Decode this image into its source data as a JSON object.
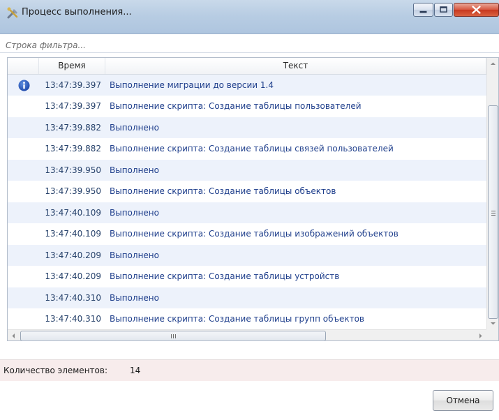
{
  "window": {
    "title": "Процесс выполнения...",
    "icon": "tools-icon"
  },
  "filter": {
    "placeholder": "Строка фильтра..."
  },
  "grid": {
    "columns": {
      "icon": "",
      "time": "Время",
      "text": "Текст"
    },
    "rows": [
      {
        "icon": "info-icon",
        "time": "13:47:39.397",
        "text": "Выполнение миграции до версии 1.4"
      },
      {
        "icon": "",
        "time": "13:47:39.397",
        "text": "Выполнение скрипта: Создание таблицы пользователей"
      },
      {
        "icon": "",
        "time": "13:47:39.882",
        "text": "Выполнено"
      },
      {
        "icon": "",
        "time": "13:47:39.882",
        "text": "Выполнение скрипта: Создание таблицы связей пользователей"
      },
      {
        "icon": "",
        "time": "13:47:39.950",
        "text": "Выполнено"
      },
      {
        "icon": "",
        "time": "13:47:39.950",
        "text": "Выполнение скрипта: Создание таблицы объектов"
      },
      {
        "icon": "",
        "time": "13:47:40.109",
        "text": "Выполнено"
      },
      {
        "icon": "",
        "time": "13:47:40.109",
        "text": "Выполнение скрипта: Создание таблицы изображений объектов"
      },
      {
        "icon": "",
        "time": "13:47:40.209",
        "text": "Выполнено"
      },
      {
        "icon": "",
        "time": "13:47:40.209",
        "text": "Выполнение скрипта: Создание таблицы устройств"
      },
      {
        "icon": "",
        "time": "13:47:40.310",
        "text": "Выполнено"
      },
      {
        "icon": "",
        "time": "13:47:40.310",
        "text": "Выполнение скрипта: Создание таблицы групп объектов"
      }
    ]
  },
  "status": {
    "label": "Количество элементов:",
    "count": "14"
  },
  "buttons": {
    "cancel": "Отмена"
  },
  "colors": {
    "row_alt": "#edf2fb",
    "text": "#1f3f8c",
    "status_bg": "#f7ecec"
  }
}
